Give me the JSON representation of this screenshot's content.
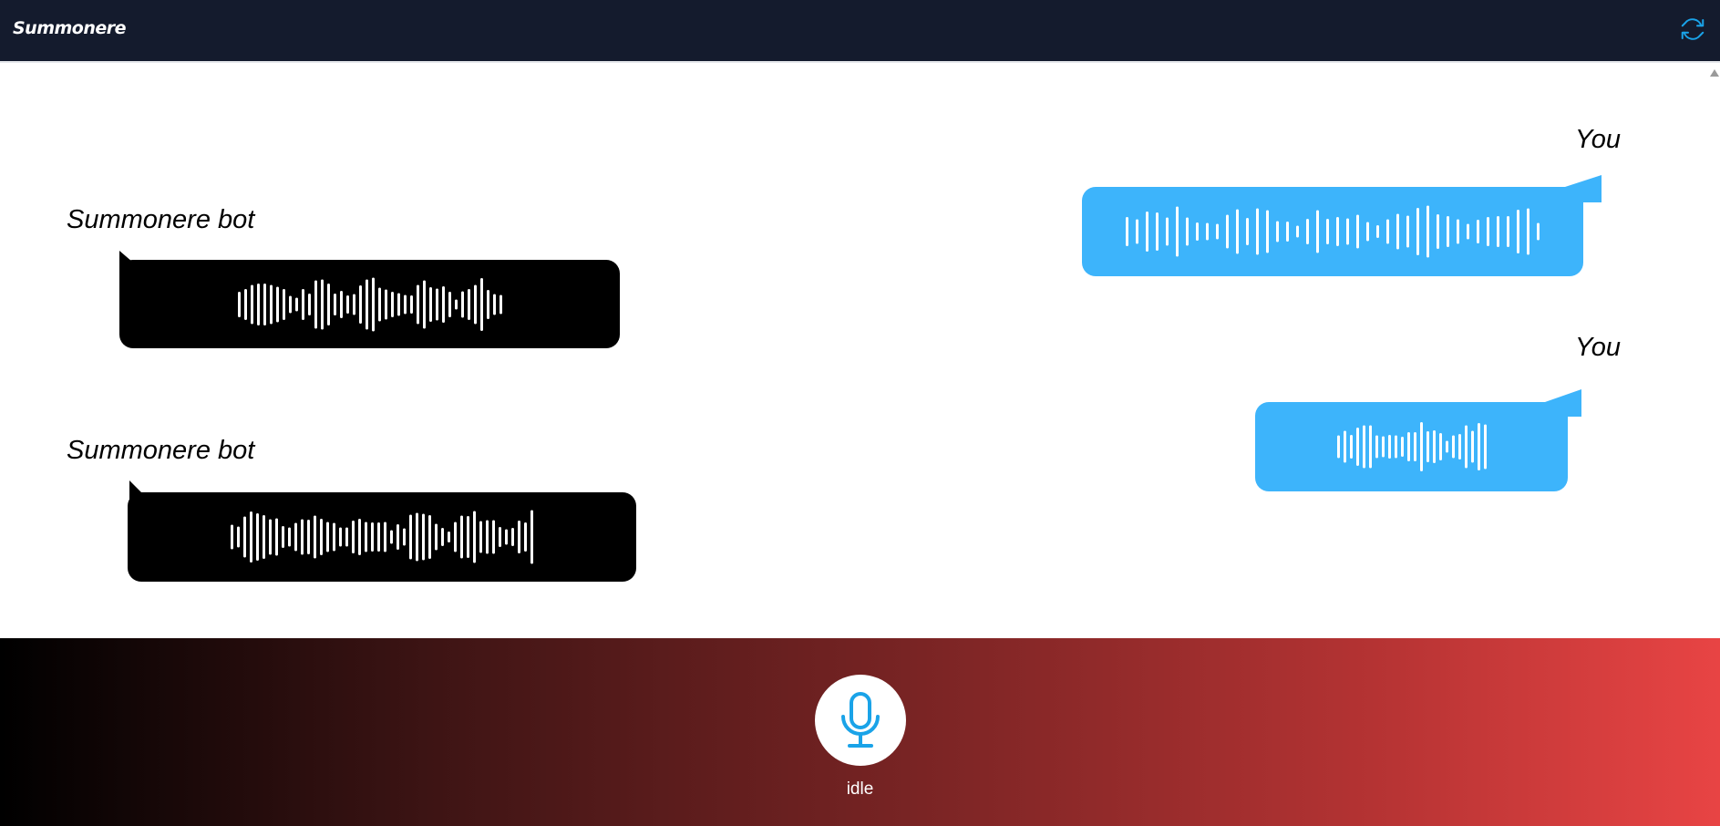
{
  "app": {
    "title": "Summonere"
  },
  "header": {
    "refresh_icon": "refresh-icon"
  },
  "messages": [
    {
      "sender": "You",
      "role": "user",
      "type": "voice"
    },
    {
      "sender": "Summonere bot",
      "role": "bot",
      "type": "voice"
    },
    {
      "sender": "You",
      "role": "user",
      "type": "voice"
    },
    {
      "sender": "Summonere bot",
      "role": "bot",
      "type": "voice"
    }
  ],
  "footer": {
    "mic_icon": "microphone-icon",
    "status": "idle"
  },
  "colors": {
    "header_bg": "#141b2d",
    "user_bubble": "#3db4fb",
    "bot_bubble": "#000000",
    "accent": "#1aa3e8",
    "footer_gradient_start": "#000000",
    "footer_gradient_end": "#e84444"
  }
}
